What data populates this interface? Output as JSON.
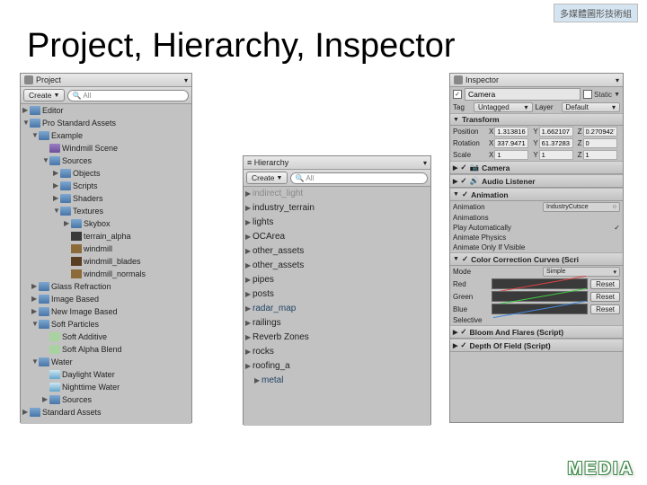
{
  "slide": {
    "title": "Project, Hierarchy, Inspector",
    "cn_tag": "多媒體圖形技術組",
    "logo": "MEDIA"
  },
  "project": {
    "tab": "Project",
    "create": "Create",
    "search_ph": "All",
    "tree": [
      {
        "d": 0,
        "t": "Editor",
        "i": "folder",
        "a": "▶"
      },
      {
        "d": 0,
        "t": "Pro Standard Assets",
        "i": "folder",
        "a": "▼"
      },
      {
        "d": 1,
        "t": "Example",
        "i": "folder",
        "a": "▼"
      },
      {
        "d": 2,
        "t": "Windmill Scene",
        "i": "scene",
        "a": ""
      },
      {
        "d": 2,
        "t": "Sources",
        "i": "folder",
        "a": "▼"
      },
      {
        "d": 3,
        "t": "Objects",
        "i": "folder",
        "a": "▶"
      },
      {
        "d": 3,
        "t": "Scripts",
        "i": "folder",
        "a": "▶"
      },
      {
        "d": 3,
        "t": "Shaders",
        "i": "folder",
        "a": "▶"
      },
      {
        "d": 3,
        "t": "Textures",
        "i": "folder",
        "a": "▼"
      },
      {
        "d": 4,
        "t": "Skybox",
        "i": "folder",
        "a": "▶"
      },
      {
        "d": 4,
        "t": "terrain_alpha",
        "i": "tex3",
        "a": ""
      },
      {
        "d": 4,
        "t": "windmill",
        "i": "tex2",
        "a": ""
      },
      {
        "d": 4,
        "t": "windmill_blades",
        "i": "tex",
        "a": ""
      },
      {
        "d": 4,
        "t": "windmill_normals",
        "i": "tex2",
        "a": ""
      },
      {
        "d": 1,
        "t": "Glass Refraction",
        "i": "folder",
        "a": "▶"
      },
      {
        "d": 1,
        "t": "Image Based",
        "i": "folder",
        "a": "▶"
      },
      {
        "d": 1,
        "t": "New Image Based",
        "i": "folder",
        "a": "▶"
      },
      {
        "d": 1,
        "t": "Soft Particles",
        "i": "folder",
        "a": "▼"
      },
      {
        "d": 2,
        "t": "Soft Additive",
        "i": "shader",
        "a": ""
      },
      {
        "d": 2,
        "t": "Soft Alpha Blend",
        "i": "shader",
        "a": ""
      },
      {
        "d": 1,
        "t": "Water",
        "i": "folder",
        "a": "▼"
      },
      {
        "d": 2,
        "t": "Daylight Water",
        "i": "water",
        "a": ""
      },
      {
        "d": 2,
        "t": "Nighttime Water",
        "i": "water",
        "a": ""
      },
      {
        "d": 2,
        "t": "Sources",
        "i": "folder",
        "a": "▶"
      },
      {
        "d": 0,
        "t": "Standard Assets",
        "i": "folder",
        "a": "▶"
      }
    ]
  },
  "hierarchy": {
    "tab": "Hierarchy",
    "create": "Create",
    "search_ph": "All",
    "items": [
      {
        "t": "indirect_light",
        "c": "dim"
      },
      {
        "t": "industry_terrain"
      },
      {
        "t": "lights"
      },
      {
        "t": "OCArea"
      },
      {
        "t": "other_assets"
      },
      {
        "t": "other_assets"
      },
      {
        "t": "pipes"
      },
      {
        "t": "posts"
      },
      {
        "t": "radar_map",
        "c": "blue"
      },
      {
        "t": "railings"
      },
      {
        "t": "Reverb Zones"
      },
      {
        "t": "rocks"
      },
      {
        "t": "roofing_a"
      },
      {
        "t": "metal",
        "c": "blue",
        "d": 1
      }
    ]
  },
  "inspector": {
    "tab": "Inspector",
    "name": "Camera",
    "static": "Static",
    "tag_label": "Tag",
    "tag": "Untagged",
    "layer_label": "Layer",
    "layer": "Default",
    "transform": {
      "title": "Transform",
      "pos_label": "Position",
      "pos": {
        "x": "1.313816",
        "y": "1.662107",
        "z": "0.2709427"
      },
      "rot_label": "Rotation",
      "rot": {
        "x": "337.9471",
        "y": "61.37283",
        "z": "0"
      },
      "scale_label": "Scale",
      "scale": {
        "x": "1",
        "y": "1",
        "z": "1"
      }
    },
    "comp_camera": "Camera",
    "comp_audio": "Audio Listener",
    "animation": {
      "title": "Animation",
      "anim_label": "Animation",
      "anim_slot": "IndustryCutsce",
      "anims_label": "Animations",
      "auto": "Play Automatically",
      "phys": "Animate Physics",
      "vis": "Animate Only If Visible"
    },
    "colorcorr": {
      "title": "Color Correction Curves (Scri",
      "mode_label": "Mode",
      "mode": "Simple",
      "red": "Red",
      "green": "Green",
      "blue": "Blue",
      "reset": "Reset",
      "selective": "Selective"
    },
    "bloom": "Bloom And Flares (Script)",
    "dof": "Depth Of Field (Script)"
  }
}
